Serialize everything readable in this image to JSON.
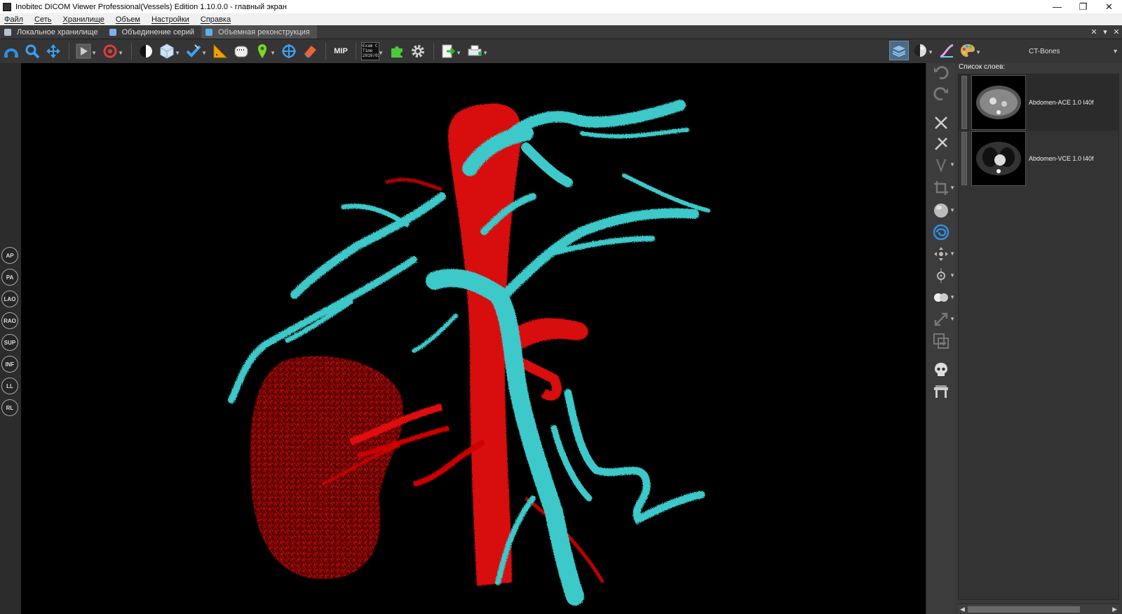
{
  "window": {
    "title": "Inobitec DICOM Viewer Professional(Vessels) Edition 1.10.0.0 - главный экран",
    "minimize": "—",
    "maximize": "❐",
    "close": "✕"
  },
  "menu": [
    "Файл",
    "Сеть",
    "Хранилище",
    "Объем",
    "Настройки",
    "Справка"
  ],
  "tabs": [
    {
      "label": "Локальное хранилище"
    },
    {
      "label": "Объединение серий"
    },
    {
      "label": "Объемная реконструкция",
      "active": true
    }
  ],
  "tab_controls": [
    "✕",
    "▾",
    "✕"
  ],
  "toolbar": {
    "mip_label": "MIP",
    "exam_label_1": "Exam C",
    "exam_label_2": "Time",
    "exam_label_3": "2010/02",
    "preset": "CT-Bones"
  },
  "orientation_buttons": [
    "AP",
    "PA",
    "LAO",
    "RAO",
    "SUP",
    "INF",
    "LL",
    "RL"
  ],
  "layers": {
    "header": "Список слоев:",
    "items": [
      {
        "name": "Abdomen-ACE  1.0  I40f"
      },
      {
        "name": "Abdomen-VCE  1.0  I40f"
      }
    ]
  },
  "colors": {
    "artery": "#e01010",
    "vein": "#3ec9c9",
    "accent_blue": "#2f8fe0"
  }
}
